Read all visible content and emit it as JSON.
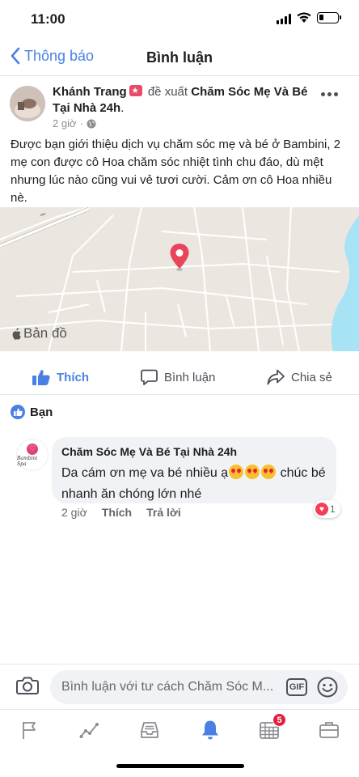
{
  "status_bar": {
    "time": "11:00"
  },
  "nav": {
    "back_label": "Thông báo",
    "title": "Bình luận"
  },
  "post": {
    "author": "Khánh Trang",
    "verb": "đề xuất",
    "page": "Chăm Sóc Mẹ Và Bé Tại Nhà 24h",
    "page_suffix": ".",
    "time": "2 giờ",
    "privacy_icon": "globe-icon",
    "text": "Được bạn giới thiệu dịch vụ chăm sóc mẹ và bé ở Bambini, 2 mẹ con được cô Hoa chăm sóc nhiệt tình chu đáo, dù mệt nhưng lúc nào cũng vui vẻ tươi cười. Cảm ơn cô Hoa nhiều nè.",
    "map_label": "Bản đồ"
  },
  "actions": {
    "like": "Thích",
    "comment": "Bình luận",
    "share": "Chia sẻ"
  },
  "friends_label": "Bạn",
  "comment": {
    "author": "Chăm Sóc Mẹ Và Bé Tại Nhà 24h",
    "text_before": "Da cám ơn mẹ va bé nhiều ạ",
    "text_after": " chúc bé nhanh ăn chóng lớn nhé",
    "emoji_count": 3,
    "avatar_text": "Bambini Spa",
    "time": "2 giờ",
    "like": "Thích",
    "reply": "Trả lời",
    "reaction_count": "1"
  },
  "composer": {
    "placeholder": "Bình luận với tư cách Chăm Sóc M...",
    "gif": "GIF"
  },
  "tab_bar": {
    "items": [
      {
        "icon": "flag-icon"
      },
      {
        "icon": "insights-icon"
      },
      {
        "icon": "inbox-icon"
      },
      {
        "icon": "bell-icon",
        "active": true
      },
      {
        "icon": "calendar-icon",
        "badge": "5"
      },
      {
        "icon": "briefcase-icon"
      }
    ]
  },
  "colors": {
    "accent": "#4a80e6",
    "badge": "#e41e3f",
    "map_bg": "#ebe7e0",
    "pin": "#e8445a"
  }
}
